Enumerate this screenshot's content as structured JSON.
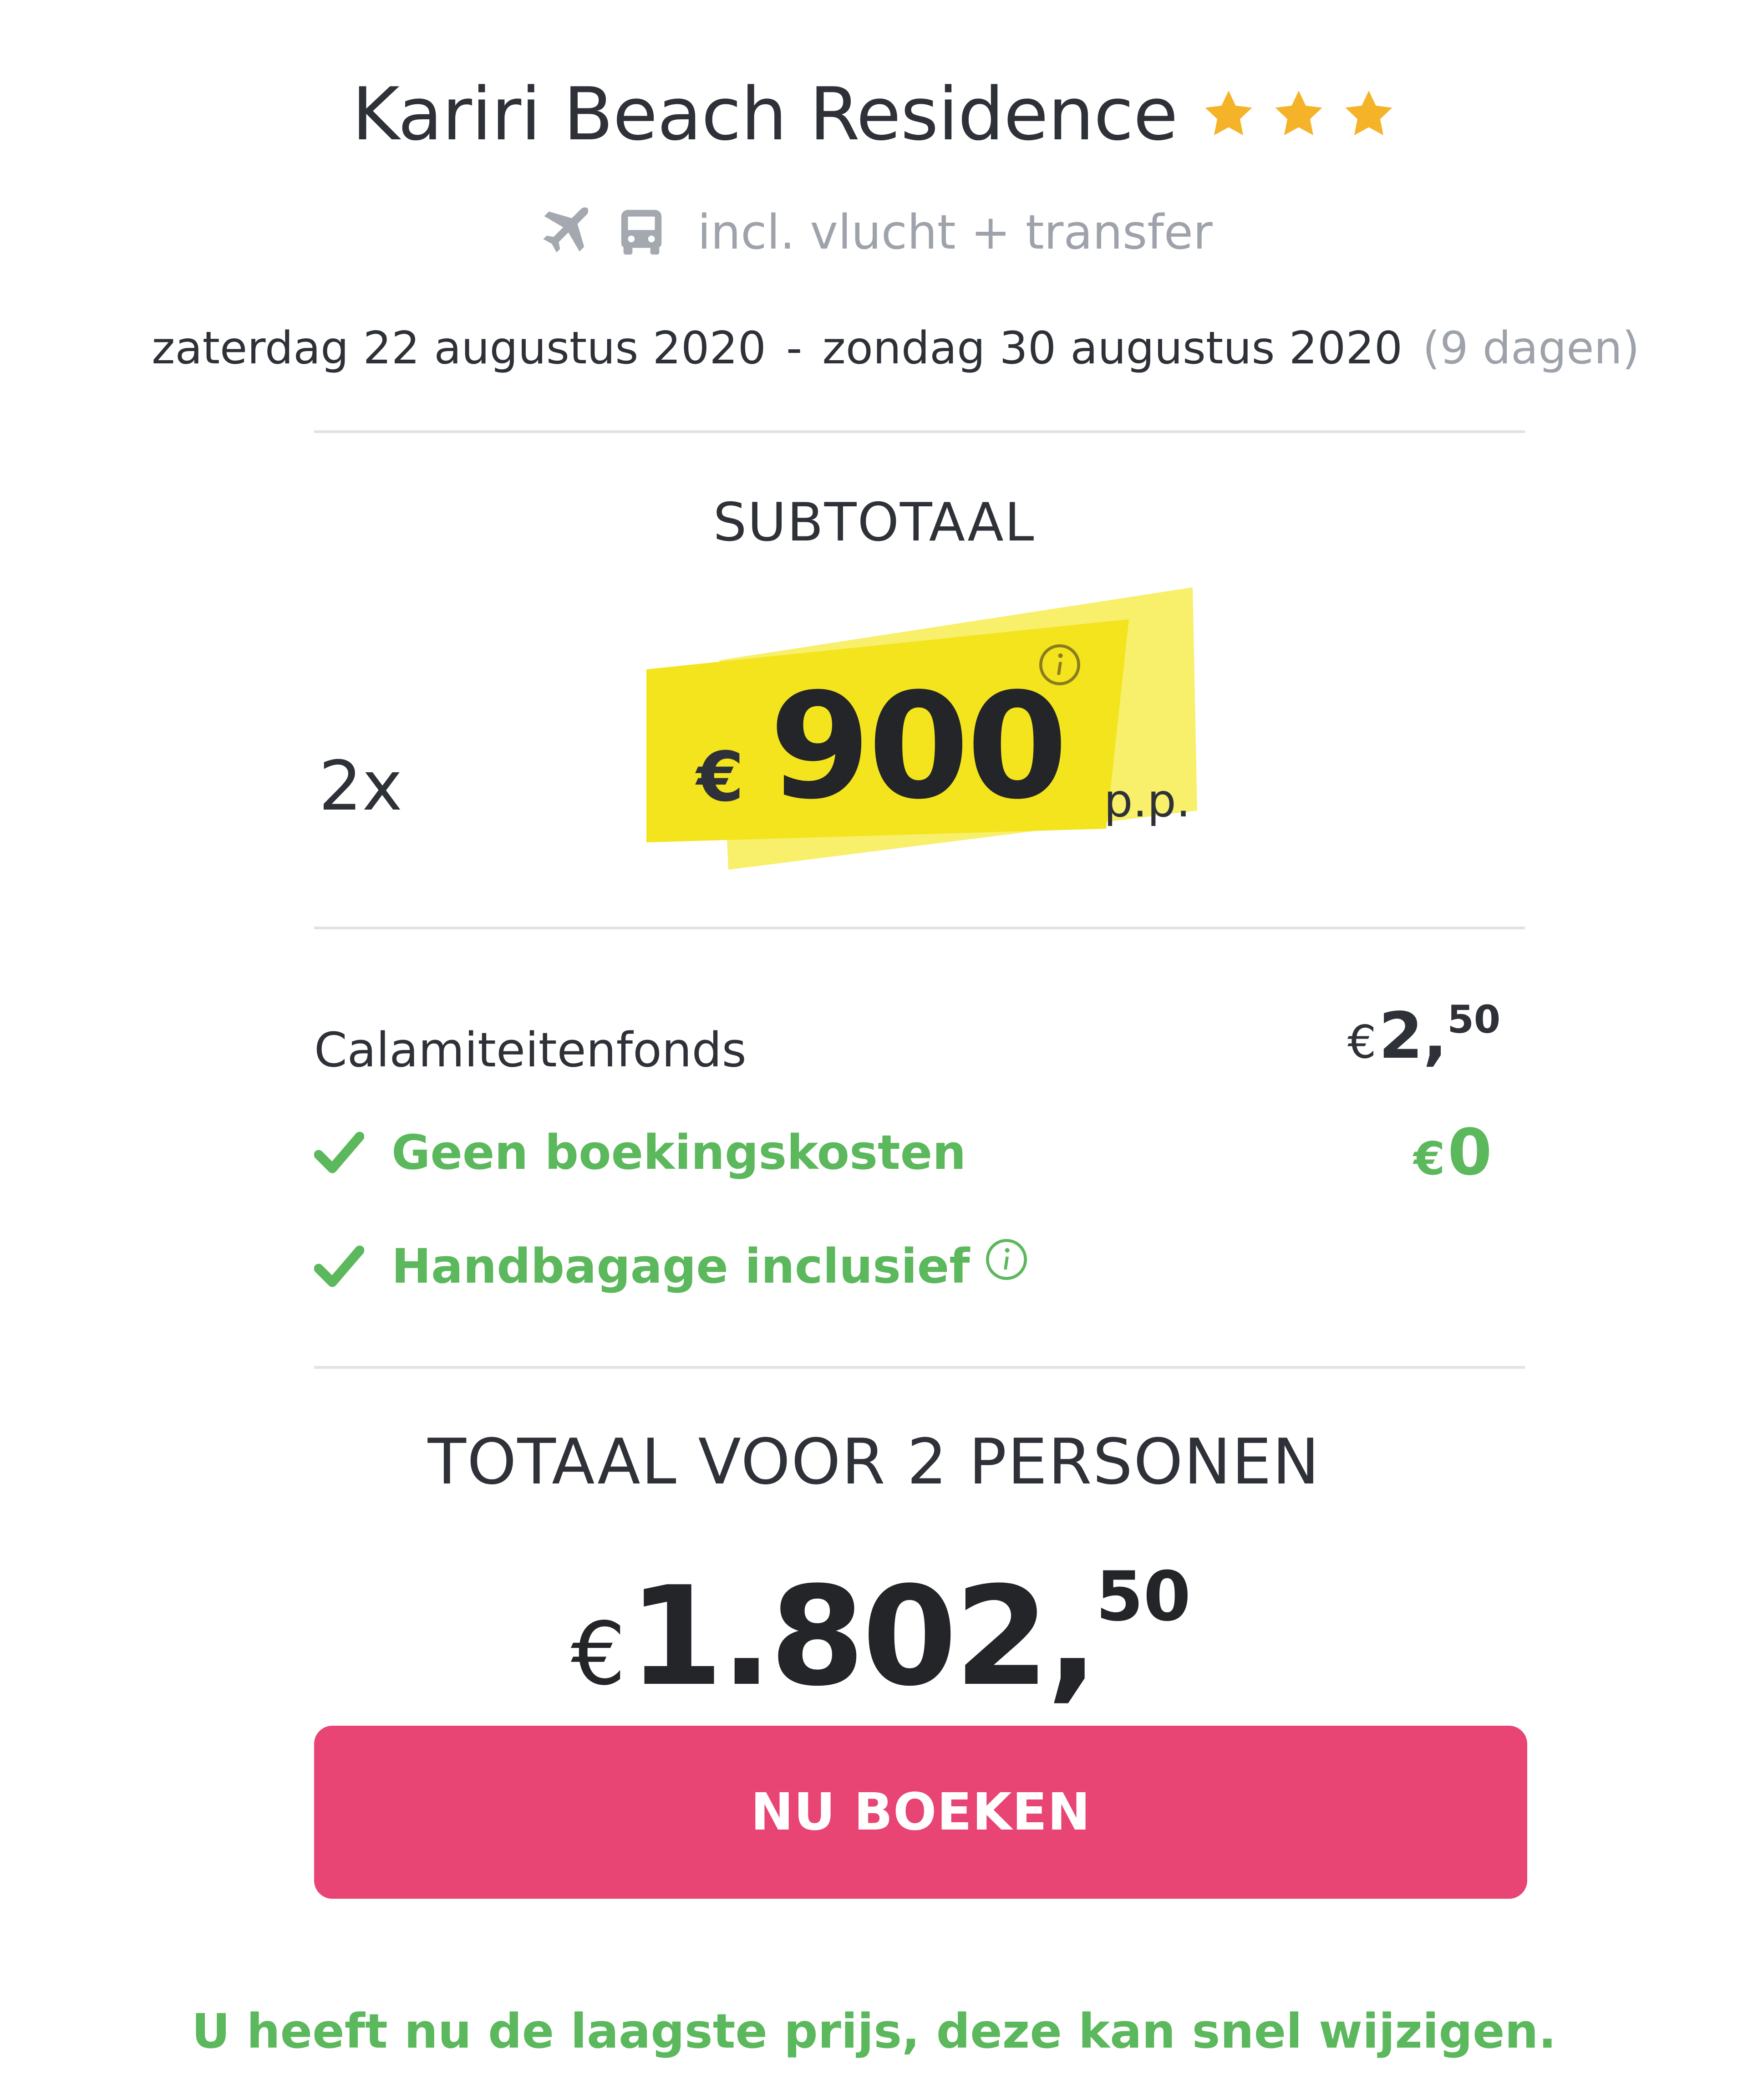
{
  "hotel": {
    "name": "Kariri Beach Residence",
    "star_rating": 3,
    "star_color": "#f5b32a",
    "included": "incl. vlucht + transfer",
    "included_icons": [
      "plane-icon",
      "bus-icon"
    ]
  },
  "dates": {
    "start": "zaterdag 22 augustus 2020",
    "separator": "-",
    "end": "zondag 30 augustus 2020",
    "duration": "(9 dagen)"
  },
  "subtotal": {
    "heading": "SUBTOTAAL",
    "pax": "2x",
    "currency": "€",
    "amount": "900",
    "per_person": "p.p.",
    "highlight_color": "#f6e824"
  },
  "extras": {
    "calamity": {
      "label": "Calamiteitenfonds",
      "currency": "€",
      "amount": "2,",
      "cents": "50"
    },
    "booking_fee": {
      "label": "Geen boekingskosten",
      "currency": "€",
      "amount": "0"
    },
    "hand_luggage": {
      "label": "Handbagage inclusief"
    },
    "check_color": "#5cb85c"
  },
  "total": {
    "heading": "TOTAAL VOOR 2 PERSONEN",
    "currency": "€",
    "amount": "1.802,",
    "cents": "50"
  },
  "actions": {
    "book_label": "NU BOEKEN",
    "button_color": "#e84474"
  },
  "footer": {
    "note": "U heeft nu de laagste prijs, deze kan snel wijzigen."
  }
}
